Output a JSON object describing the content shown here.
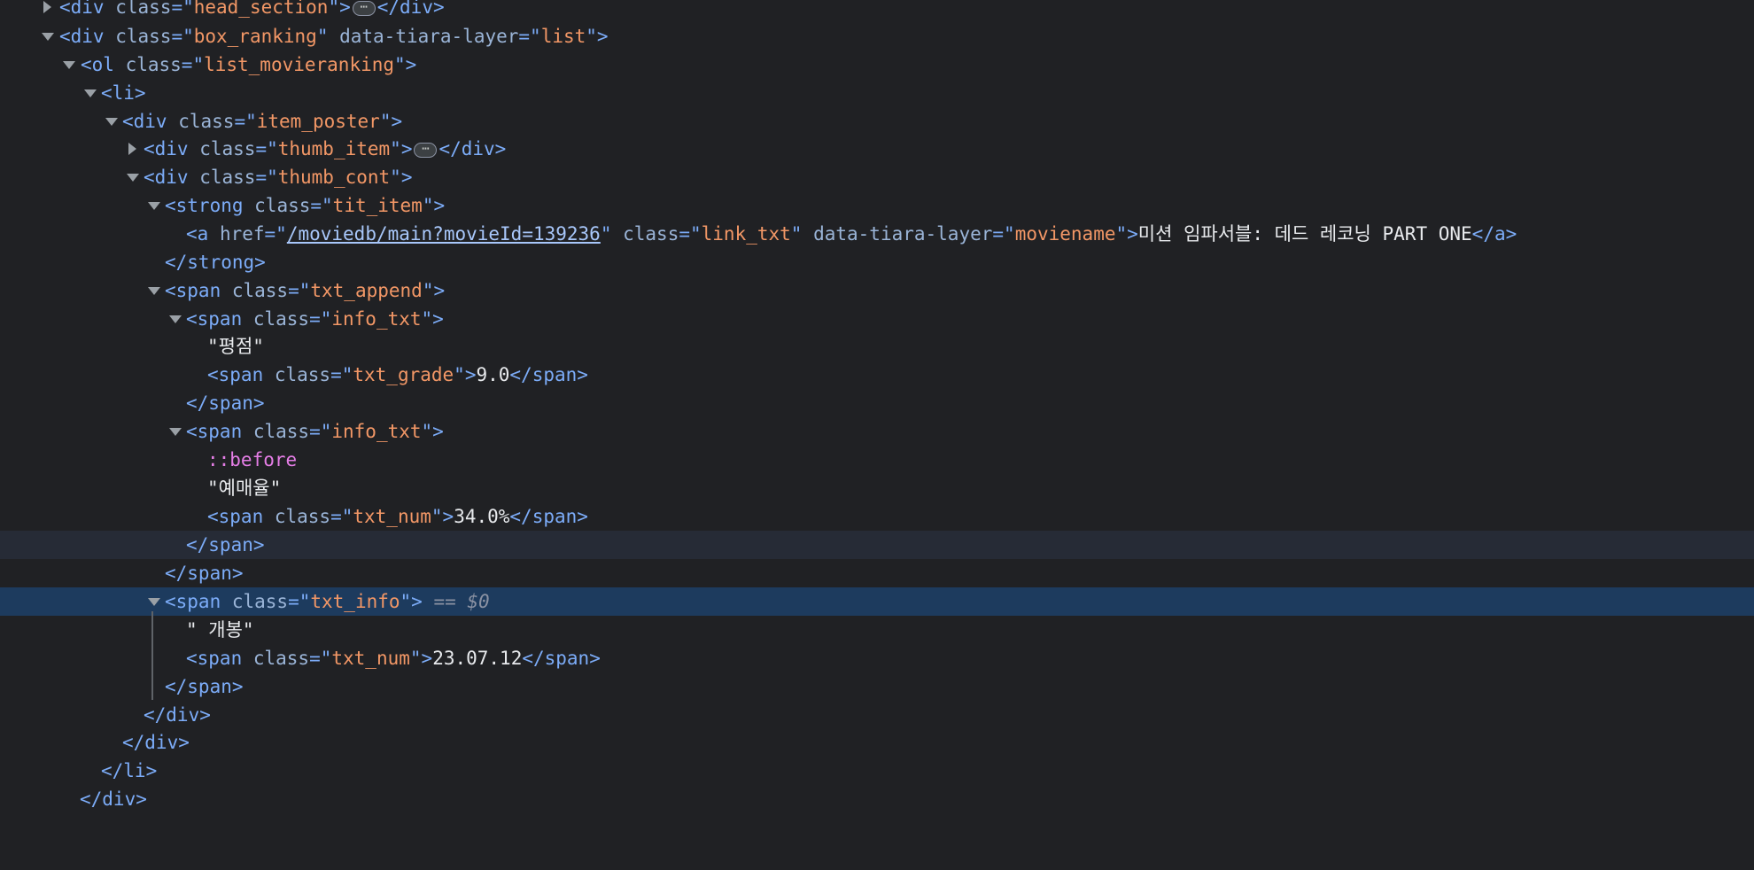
{
  "lines": [
    {
      "t1": "<div ",
      "a1": "class",
      "eq1": "=\"",
      "v1": "head_section",
      "close1": "\">",
      "t2": "</div>",
      "ellipsis": "⋯"
    },
    {
      "t1": "<div ",
      "a1": "class",
      "eq1": "=\"",
      "v1": "box_ranking",
      "q1": "\" ",
      "a2": "data-tiara-layer",
      "eq2": "=\"",
      "v2": "list",
      "close": "\">"
    },
    {
      "t1": "<ol ",
      "a1": "class",
      "eq1": "=\"",
      "v1": "list_movieranking",
      "close": "\">"
    },
    {
      "t1": "<li>"
    },
    {
      "t1": "<div ",
      "a1": "class",
      "eq1": "=\"",
      "v1": "item_poster",
      "close": "\">"
    },
    {
      "t1": "<div ",
      "a1": "class",
      "eq1": "=\"",
      "v1": "thumb_item",
      "close1": "\">",
      "t2": "</div>",
      "ellipsis": "⋯"
    },
    {
      "t1": "<div ",
      "a1": "class",
      "eq1": "=\"",
      "v1": "thumb_cont",
      "close": "\">"
    },
    {
      "t1": "<strong ",
      "a1": "class",
      "eq1": "=\"",
      "v1": "tit_item",
      "close": "\">"
    },
    {
      "t1": "<a ",
      "a1": "href",
      "eq1": "=\"",
      "href": "/moviedb/main?movieId=139236",
      "q1": "\" ",
      "a2": "class",
      "eq2": "=\"",
      "v2": "link_txt",
      "q2": "\" ",
      "a3": "data-tiara-layer",
      "eq3": "=\"",
      "v3": "moviename",
      "close": "\">",
      "text": "미션 임파서블: 데드 레코닝 PART ONE",
      "t2": "</a>"
    },
    {
      "t1": "</strong>"
    },
    {
      "t1": "<span ",
      "a1": "class",
      "eq1": "=\"",
      "v1": "txt_append",
      "close": "\">"
    },
    {
      "t1": "<span ",
      "a1": "class",
      "eq1": "=\"",
      "v1": "info_txt",
      "close": "\">"
    },
    {
      "text": "\"평점\""
    },
    {
      "t1": "<span ",
      "a1": "class",
      "eq1": "=\"",
      "v1": "txt_grade",
      "close": "\">",
      "text": "9.0",
      "t2": "</span>"
    },
    {
      "t1": "</span>"
    },
    {
      "t1": "<span ",
      "a1": "class",
      "eq1": "=\"",
      "v1": "info_txt",
      "close": "\">"
    },
    {
      "pseudo": "::before"
    },
    {
      "text": "\"예매율\""
    },
    {
      "t1": "<span ",
      "a1": "class",
      "eq1": "=\"",
      "v1": "txt_num",
      "close": "\">",
      "text": "34.0%",
      "t2": "</span>"
    },
    {
      "t1": "</span>"
    },
    {
      "t1": "</span>"
    },
    {
      "t1": "<span ",
      "a1": "class",
      "eq1": "=\"",
      "v1": "txt_info",
      "close": "\">",
      "eqref": " == $0"
    },
    {
      "text": "\" 개봉\""
    },
    {
      "t1": "<span ",
      "a1": "class",
      "eq1": "=\"",
      "v1": "txt_num",
      "close": "\">",
      "text": "23.07.12",
      "t2": "</span>"
    },
    {
      "t1": "</span>"
    },
    {
      "t1": "</div>"
    },
    {
      "t1": "</div>"
    },
    {
      "t1": "</li>"
    },
    {
      "t1": "</div>"
    }
  ]
}
